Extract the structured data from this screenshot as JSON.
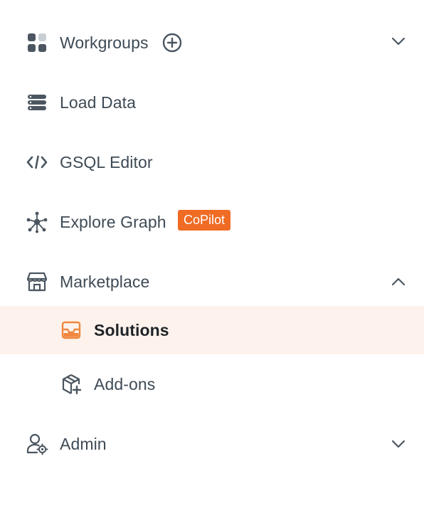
{
  "nav": {
    "workgroups": {
      "label": "Workgroups",
      "icon": "grid-icon",
      "add_icon": "plus-circle-icon",
      "chevron": "chevron-down-icon"
    },
    "load_data": {
      "label": "Load Data",
      "icon": "database-icon"
    },
    "gsql_editor": {
      "label": "GSQL Editor",
      "icon": "code-icon"
    },
    "explore_graph": {
      "label": "Explore Graph",
      "icon": "graph-icon",
      "badge": "CoPilot"
    },
    "marketplace": {
      "label": "Marketplace",
      "icon": "store-icon",
      "chevron": "chevron-up-icon",
      "children": [
        {
          "label": "Solutions",
          "icon": "inbox-icon",
          "selected": true
        },
        {
          "label": "Add-ons",
          "icon": "package-plus-icon"
        }
      ]
    },
    "admin": {
      "label": "Admin",
      "icon": "user-gear-icon",
      "chevron": "chevron-down-icon"
    }
  },
  "colors": {
    "text": "#3e4a55",
    "selected_text": "#1f2328",
    "selected_bg": "#fdf3ec",
    "accent": "#f06b24",
    "icon": "#4b5660",
    "selected_icon": "#f0883e"
  }
}
